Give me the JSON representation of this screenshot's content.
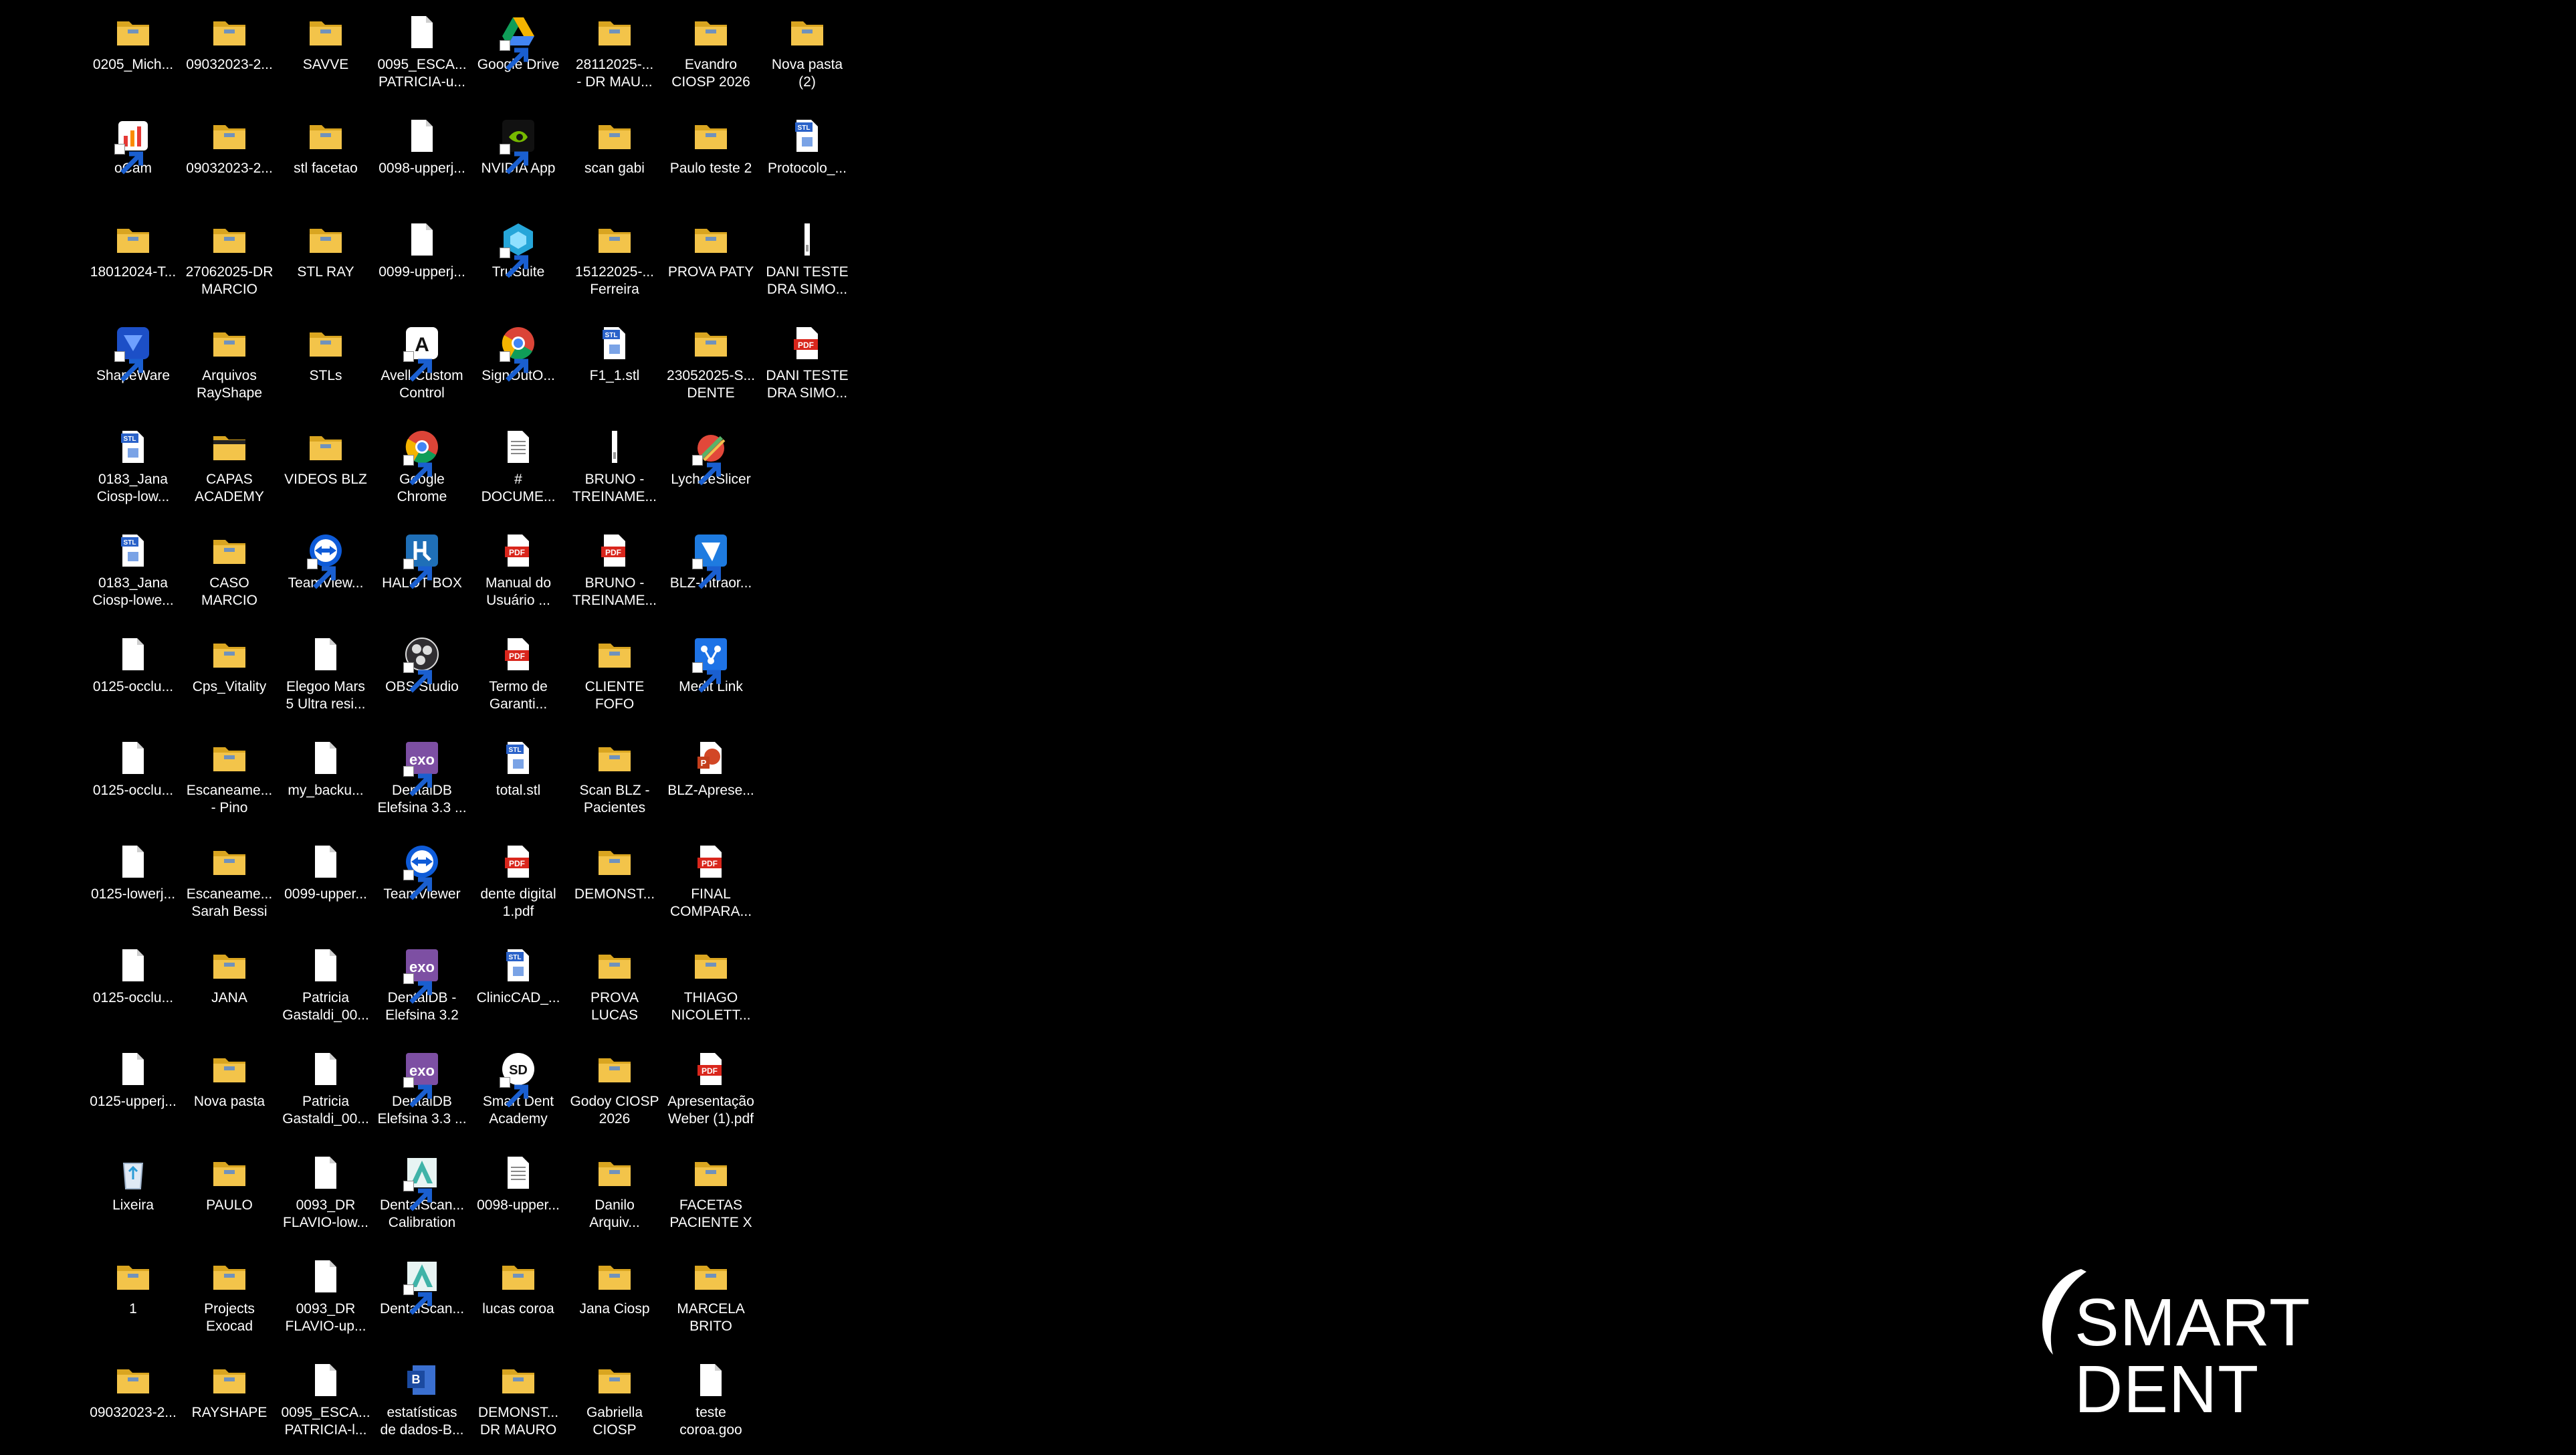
{
  "colors": {
    "background": "#000000",
    "folder": "#f3c44a",
    "folder_dark": "#d9a520",
    "file": "#ffffff",
    "pdf": "#d9261c",
    "stl": "#2a62c9",
    "label_text": "#ffffff"
  },
  "logo": {
    "text": "SMART DENT"
  },
  "desktop": {
    "columns": [
      [
        {
          "label": "0205_Mich...",
          "icon": "folder-icon"
        },
        {
          "label": "oCam",
          "icon": "ocam-app-icon"
        },
        {
          "label": "18012024-T...",
          "icon": "folder-icon"
        },
        {
          "label": "ShapeWare",
          "icon": "shapeware-app-icon"
        },
        {
          "label": "0183_Jana\nCiosp-low...",
          "icon": "stl-file-icon"
        },
        {
          "label": "0183_Jana\nCiosp-lowe...",
          "icon": "stl-file-icon"
        },
        {
          "label": "0125-occlu...",
          "icon": "file-icon"
        },
        {
          "label": "0125-occlu...",
          "icon": "file-icon"
        },
        {
          "label": "0125-lowerj...",
          "icon": "file-icon"
        },
        {
          "label": "0125-occlu...",
          "icon": "file-icon"
        },
        {
          "label": "0125-upperj...",
          "icon": "file-icon"
        },
        {
          "label": "Lixeira",
          "icon": "recycle-bin-icon"
        },
        {
          "label": "1",
          "icon": "folder-icon"
        },
        {
          "label": "09032023-2...",
          "icon": "folder-icon"
        }
      ],
      [
        {
          "label": "09032023-2...",
          "icon": "folder-icon"
        },
        {
          "label": "09032023-2...",
          "icon": "folder-icon"
        },
        {
          "label": "27062025-DR\nMARCIO",
          "icon": "folder-icon"
        },
        {
          "label": "Arquivos\nRayShape",
          "icon": "folder-icon"
        },
        {
          "label": "CAPAS\nACADEMY",
          "icon": "folder-dark-icon"
        },
        {
          "label": "CASO\nMARCIO",
          "icon": "folder-icon"
        },
        {
          "label": "Cps_Vitality",
          "icon": "folder-icon"
        },
        {
          "label": "Escaneame...\n- Pino",
          "icon": "folder-icon"
        },
        {
          "label": "Escaneame...\nSarah Bessi",
          "icon": "folder-icon"
        },
        {
          "label": "JANA",
          "icon": "folder-icon"
        },
        {
          "label": "Nova pasta",
          "icon": "folder-icon"
        },
        {
          "label": "PAULO",
          "icon": "folder-icon"
        },
        {
          "label": "Projects\nExocad",
          "icon": "folder-icon"
        },
        {
          "label": "RAYSHAPE",
          "icon": "folder-icon"
        }
      ],
      [
        {
          "label": "SAVVE",
          "icon": "folder-icon"
        },
        {
          "label": "stl facetao",
          "icon": "folder-icon"
        },
        {
          "label": "STL RAY",
          "icon": "folder-icon"
        },
        {
          "label": "STLs",
          "icon": "folder-icon"
        },
        {
          "label": "VIDEOS BLZ",
          "icon": "folder-icon"
        },
        {
          "label": "TeamView...",
          "icon": "teamviewer-icon"
        },
        {
          "label": "Elegoo Mars\n5 Ultra resi...",
          "icon": "file-icon"
        },
        {
          "label": "my_backu...",
          "icon": "file-icon"
        },
        {
          "label": "0099-upper...",
          "icon": "file-icon"
        },
        {
          "label": "Patricia\nGastaldi_00...",
          "icon": "file-icon"
        },
        {
          "label": "Patricia\nGastaldi_00...",
          "icon": "file-icon"
        },
        {
          "label": "0093_DR\nFLAVIO-low...",
          "icon": "file-icon"
        },
        {
          "label": "0093_DR\nFLAVIO-up...",
          "icon": "file-icon"
        },
        {
          "label": "0095_ESCA...\nPATRICIA-l...",
          "icon": "file-icon"
        }
      ],
      [
        {
          "label": "0095_ESCA...\nPATRICIA-u...",
          "icon": "file-icon"
        },
        {
          "label": "0098-upperj...",
          "icon": "file-icon"
        },
        {
          "label": "0099-upperj...",
          "icon": "file-icon"
        },
        {
          "label": "Avell Custom\nControl",
          "icon": "avell-app-icon"
        },
        {
          "label": "Google\nChrome",
          "icon": "chrome-icon"
        },
        {
          "label": "HALOT BOX",
          "icon": "halot-box-icon"
        },
        {
          "label": "OBS Studio",
          "icon": "obs-icon"
        },
        {
          "label": "DentalDB\nElefsina 3.3 ...",
          "icon": "exocad-icon"
        },
        {
          "label": "TeamViewer",
          "icon": "teamviewer-icon"
        },
        {
          "label": "DentalDB -\nElefsina 3.2",
          "icon": "exocad-icon"
        },
        {
          "label": "DentalDB\nElefsina 3.3 ...",
          "icon": "exocad-icon"
        },
        {
          "label": "DentalScan...\nCalibration",
          "icon": "dentalscan-icon"
        },
        {
          "label": "DentalScan...",
          "icon": "dentalscan-icon"
        },
        {
          "label": "estatísticas\nde dados-B...",
          "icon": "word-doc-icon"
        }
      ],
      [
        {
          "label": "Google Drive",
          "icon": "google-drive-icon"
        },
        {
          "label": "NVIDIA App",
          "icon": "nvidia-icon"
        },
        {
          "label": "TruSuite",
          "icon": "trusuite-icon"
        },
        {
          "label": "SignOutO...",
          "icon": "chrome-icon"
        },
        {
          "label": "#\nDOCUME...",
          "icon": "text-file-icon"
        },
        {
          "label": "Manual do\nUsuário ...",
          "icon": "pdf-icon"
        },
        {
          "label": "Termo de\nGaranti...",
          "icon": "pdf-icon"
        },
        {
          "label": "total.stl",
          "icon": "stl-file-icon"
        },
        {
          "label": "dente digital\n1.pdf",
          "icon": "pdf-icon"
        },
        {
          "label": "ClinicCAD_...",
          "icon": "stl-file-icon"
        },
        {
          "label": "Smart Dent\nAcademy",
          "icon": "smartdent-app-icon"
        },
        {
          "label": "0098-upper...",
          "icon": "text-file-icon"
        },
        {
          "label": "lucas coroa",
          "icon": "folder-icon"
        },
        {
          "label": "DEMONST...\nDR MAURO",
          "icon": "folder-icon"
        }
      ],
      [
        {
          "label": "28112025-...\n- DR MAU...",
          "icon": "folder-icon"
        },
        {
          "label": "scan gabi",
          "icon": "folder-icon"
        },
        {
          "label": "15122025-...\nFerreira",
          "icon": "folder-icon"
        },
        {
          "label": "F1_1.stl",
          "icon": "stl-file-icon"
        },
        {
          "label": "BRUNO -\nTREINAME...",
          "icon": "file-thin-icon"
        },
        {
          "label": "BRUNO -\nTREINAME...",
          "icon": "pdf-icon"
        },
        {
          "label": "CLIENTE\nFOFO",
          "icon": "folder-icon"
        },
        {
          "label": "Scan BLZ -\nPacientes",
          "icon": "folder-icon"
        },
        {
          "label": "DEMONST...",
          "icon": "folder-icon"
        },
        {
          "label": "PROVA\nLUCAS",
          "icon": "folder-icon"
        },
        {
          "label": "Godoy CIOSP\n2026",
          "icon": "folder-icon"
        },
        {
          "label": "Danilo\nArquiv...",
          "icon": "folder-icon"
        },
        {
          "label": "Jana Ciosp",
          "icon": "folder-icon"
        },
        {
          "label": "Gabriella\nCIOSP",
          "icon": "folder-icon"
        }
      ],
      [
        {
          "label": "Evandro\nCIOSP 2026",
          "icon": "folder-icon"
        },
        {
          "label": "Paulo teste 2",
          "icon": "folder-icon"
        },
        {
          "label": "PROVA  PATY",
          "icon": "folder-icon"
        },
        {
          "label": "23052025-S...\nDENTE",
          "icon": "folder-icon"
        },
        {
          "label": "LycheeSlicer",
          "icon": "lychee-icon"
        },
        {
          "label": "BLZ-Intraor...",
          "icon": "blz-app-icon"
        },
        {
          "label": "Medit Link",
          "icon": "medit-link-icon"
        },
        {
          "label": "BLZ-Aprese...",
          "icon": "powerpoint-icon"
        },
        {
          "label": "FINAL\nCOMPARA...",
          "icon": "pdf-icon"
        },
        {
          "label": "THIAGO\nNICOLETT...",
          "icon": "folder-icon"
        },
        {
          "label": "Apresentação\nWeber (1).pdf",
          "icon": "pdf-icon"
        },
        {
          "label": "FACETAS\nPACIENTE X",
          "icon": "folder-icon"
        },
        {
          "label": "MARCELA\nBRITO",
          "icon": "folder-icon"
        },
        {
          "label": "teste\ncoroa.goo",
          "icon": "file-icon"
        }
      ],
      [
        {
          "label": "Nova pasta\n(2)",
          "icon": "folder-icon"
        },
        {
          "label": "Protocolo_...",
          "icon": "stl-file-icon"
        },
        {
          "label": "DANI TESTE\nDRA SIMO...",
          "icon": "file-thin-icon"
        },
        {
          "label": "DANI TESTE\nDRA SIMO...",
          "icon": "pdf-icon"
        }
      ]
    ]
  }
}
